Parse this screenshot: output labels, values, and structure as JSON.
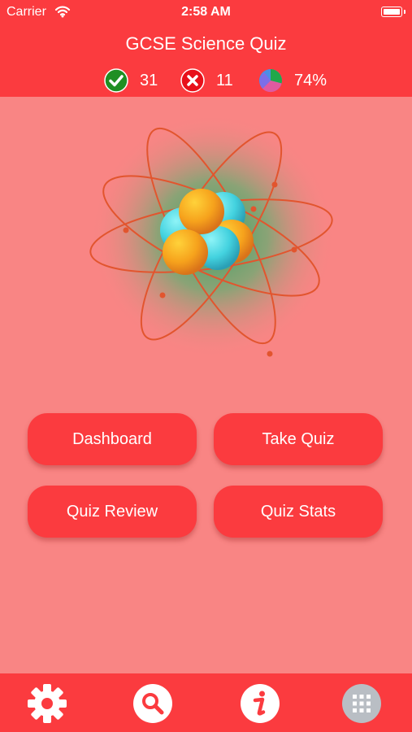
{
  "status_bar": {
    "carrier": "Carrier",
    "time": "2:58 AM"
  },
  "header": {
    "title": "GCSE Science Quiz",
    "stats": {
      "correct": "31",
      "wrong": "11",
      "percent": "74%"
    }
  },
  "buttons": {
    "dashboard": "Dashboard",
    "take_quiz": "Take Quiz",
    "quiz_review": "Quiz Review",
    "quiz_stats": "Quiz Stats"
  },
  "tabbar": {
    "icons": [
      "gear-icon",
      "search-icon",
      "info-icon",
      "grid-icon"
    ]
  },
  "colors": {
    "primary": "#fb3b3f",
    "background": "#f98584",
    "correct": "#1f8f23",
    "wrong": "#e8101a"
  }
}
